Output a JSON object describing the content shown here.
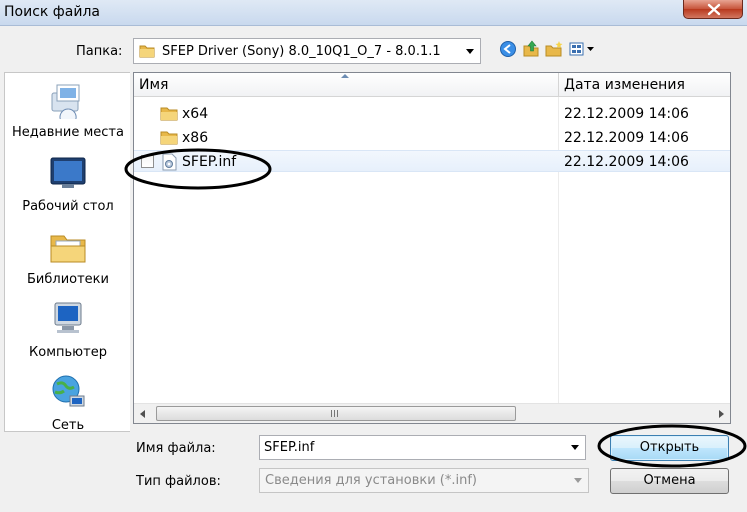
{
  "window": {
    "title": "Поиск файла"
  },
  "lookin": {
    "label": "Папка:",
    "value": "SFEP Driver (Sony) 8.0_10Q1_O_7 - 8.0.1.1"
  },
  "toolbar": {
    "icons": [
      "back-icon",
      "up-folder-icon",
      "new-folder-icon",
      "view-menu-icon"
    ]
  },
  "places": [
    {
      "label": "Недавние места",
      "icon": "recent-places-icon"
    },
    {
      "label": "Рабочий стол",
      "icon": "desktop-icon"
    },
    {
      "label": "Библиотеки",
      "icon": "libraries-icon"
    },
    {
      "label": "Компьютер",
      "icon": "computer-icon"
    },
    {
      "label": "Сеть",
      "icon": "network-icon"
    }
  ],
  "filelist": {
    "columns": [
      "Имя",
      "Дата изменения"
    ],
    "rows": [
      {
        "name": "x64",
        "date": "22.12.2009 14:06",
        "type": "folder"
      },
      {
        "name": "x86",
        "date": "22.12.2009 14:06",
        "type": "folder"
      },
      {
        "name": "SFEP.inf",
        "date": "22.12.2009 14:06",
        "type": "inf-file",
        "selected": true
      }
    ]
  },
  "filename": {
    "label": "Имя файла:",
    "value": "SFEP.inf"
  },
  "filetype": {
    "label": "Тип файлов:",
    "value": "Сведения для установки (*.inf)"
  },
  "buttons": {
    "open": "Открыть",
    "cancel": "Отмена"
  },
  "colors": {
    "selection": "#e7f0fb",
    "close_button": "#c7543a",
    "annotation": "#000000"
  }
}
